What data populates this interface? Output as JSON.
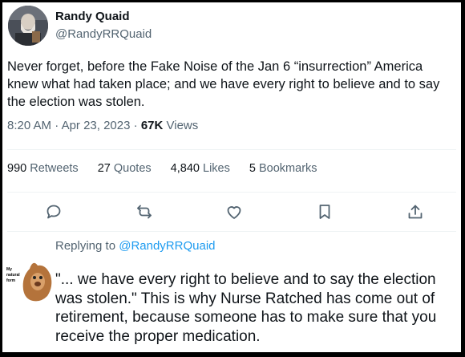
{
  "tweet": {
    "display_name": "Randy Quaid",
    "handle": "@RandyRRQuaid",
    "text": "Never forget, before the Fake Noise of the Jan 6 “insurrection” America knew what had taken place; and we have every right to believe and to say the election was stolen.",
    "time": "8:20 AM",
    "date": "Apr 23, 2023",
    "separator": "·",
    "views_count": "67K",
    "views_label": "Views"
  },
  "stats": {
    "retweets_count": "990",
    "retweets_label": "Retweets",
    "quotes_count": "27",
    "quotes_label": "Quotes",
    "likes_count": "4,840",
    "likes_label": "Likes",
    "bookmarks_count": "5",
    "bookmarks_label": "Bookmarks"
  },
  "actions": {
    "icons": [
      "reply-icon",
      "retweet-icon",
      "like-icon",
      "bookmark-icon",
      "share-icon"
    ],
    "color": "#536471"
  },
  "reply": {
    "replying_to_label": "Replying to",
    "replying_to_handle": "@RandyRRQuaid",
    "avatar_caption_1": "My",
    "avatar_caption_2": "natural",
    "avatar_caption_3": "form",
    "text": "\"... we have every right to believe and to say the election was stolen.\" This is why Nurse Ratched has come out of retirement, because someone has to make sure that you receive the proper medication."
  },
  "colors": {
    "link": "#1d9bf0",
    "secondary": "#536471",
    "primary_text": "#0f1419"
  }
}
